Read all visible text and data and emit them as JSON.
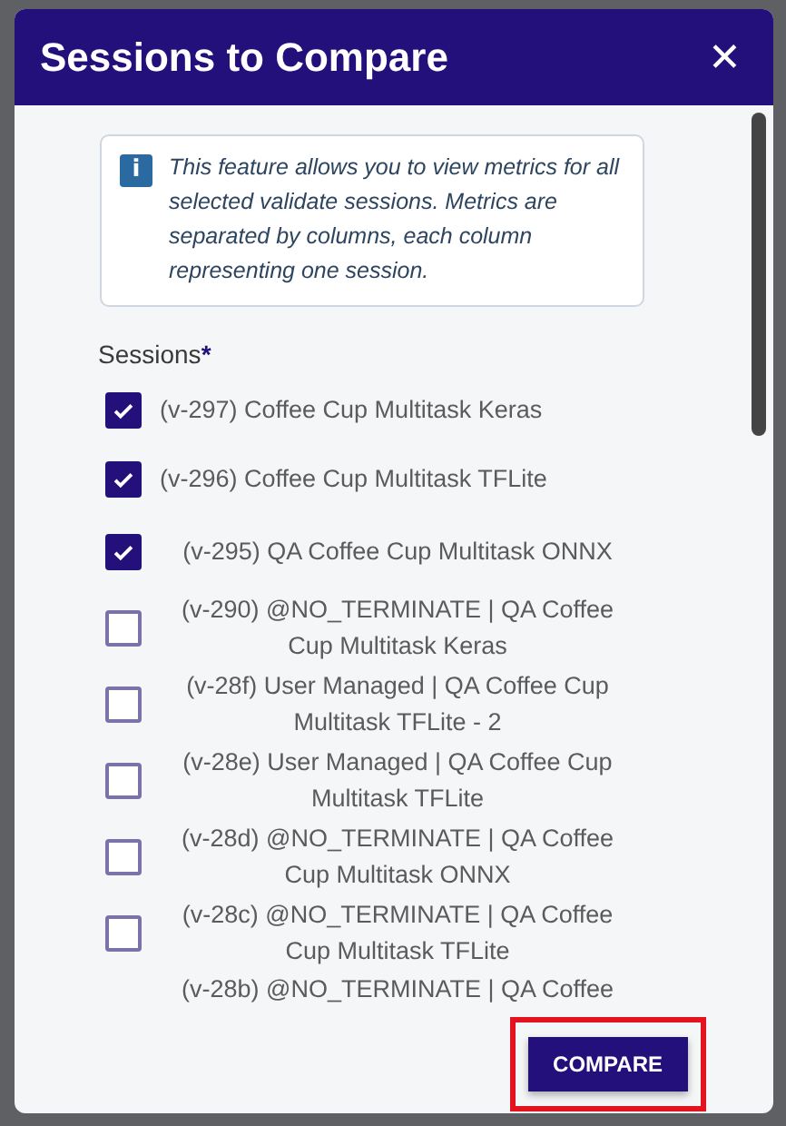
{
  "dialog": {
    "title": "Sessions to Compare",
    "close": "✕"
  },
  "info": {
    "icon": "i",
    "text": "This feature allows you to view metrics for all selected validate sessions. Metrics are separated by columns, each column representing one session."
  },
  "sessions_field": {
    "label": "Sessions",
    "required_mark": "*"
  },
  "sessions": [
    {
      "label": "(v-297) Coffee Cup Multitask Keras",
      "checked": true
    },
    {
      "label": "(v-296) Coffee Cup Multitask TFLite",
      "checked": true
    },
    {
      "label": "(v-295) QA Coffee Cup Multitask ONNX",
      "checked": true
    },
    {
      "label": "(v-290) @NO_TERMINATE | QA Coffee Cup Multitask Keras",
      "checked": false
    },
    {
      "label": "(v-28f) User Managed | QA Coffee Cup Multitask TFLite - 2",
      "checked": false
    },
    {
      "label": "(v-28e) User Managed | QA Coffee Cup Multitask TFLite",
      "checked": false
    },
    {
      "label": "(v-28d) @NO_TERMINATE | QA Coffee Cup Multitask ONNX",
      "checked": false
    },
    {
      "label": "(v-28c) @NO_TERMINATE | QA Coffee Cup Multitask TFLite",
      "checked": false
    },
    {
      "label": "(v-28b) @NO_TERMINATE | QA Coffee"
    }
  ],
  "buttons": [
    {
      "label": "COMPARE",
      "highlighted": true
    }
  ]
}
